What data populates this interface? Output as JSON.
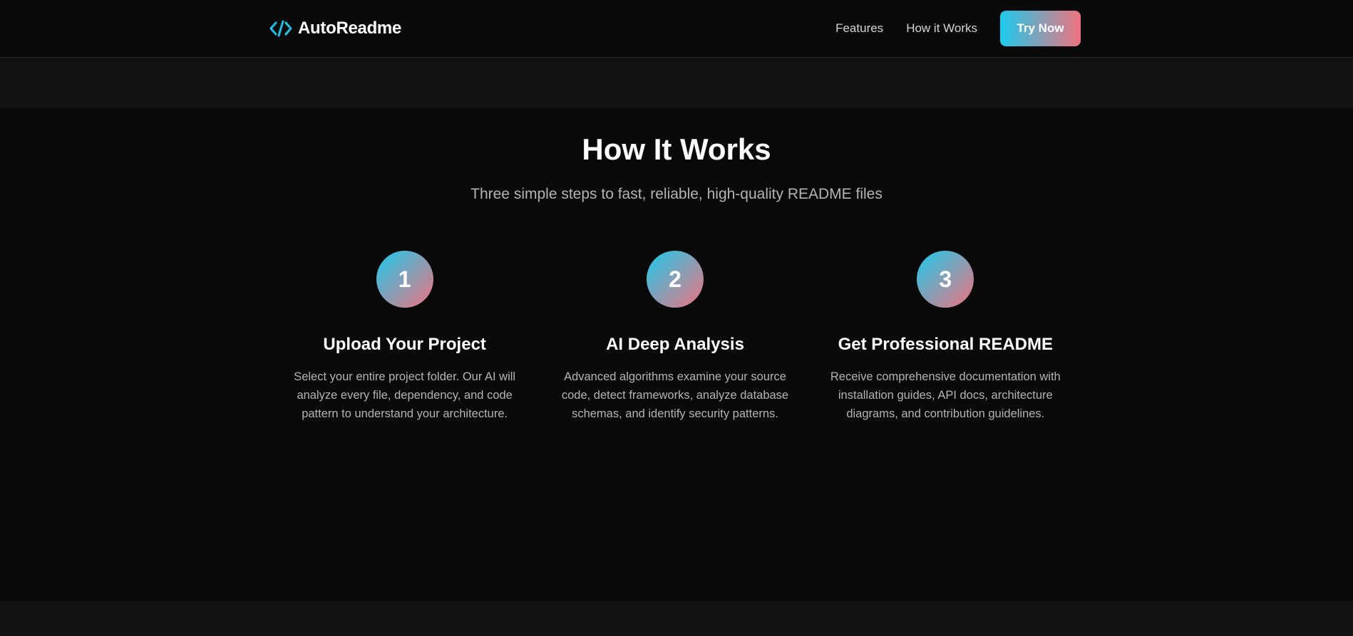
{
  "header": {
    "brand_name": "AutoReadme",
    "logo_icon": "code-brackets-icon",
    "nav": [
      {
        "label": "Features"
      },
      {
        "label": "How it Works"
      }
    ],
    "cta_label": "Try Now"
  },
  "how_it_works": {
    "title": "How It Works",
    "subtitle": "Three simple steps to fast, reliable, high-quality README files",
    "steps": [
      {
        "number": "1",
        "title": "Upload Your Project",
        "description": "Select your entire project folder. Our AI will analyze every file, dependency, and code pattern to understand your architecture."
      },
      {
        "number": "2",
        "title": "AI Deep Analysis",
        "description": "Advanced algorithms examine your source code, detect frameworks, analyze database schemas, and identify security patterns."
      },
      {
        "number": "3",
        "title": "Get Professional README",
        "description": "Receive comprehensive documentation with installation guides, API docs, architecture diagrams, and contribution guidelines."
      }
    ]
  },
  "colors": {
    "background": "#0a0a0a",
    "band": "#111111",
    "gradient_start": "#1ccbee",
    "gradient_end": "#f0727d",
    "text_muted": "#b3b3b3"
  }
}
